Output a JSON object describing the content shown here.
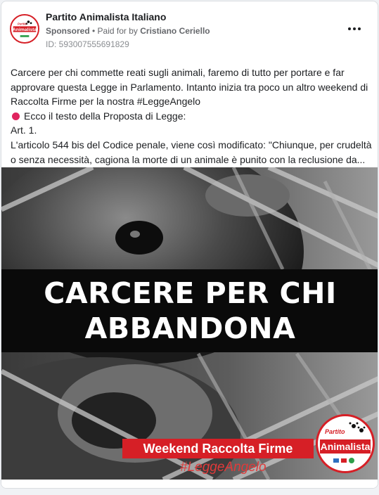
{
  "post": {
    "page_name": "Partito Animalista Italiano",
    "sponsored": "Sponsored",
    "paid_for_prefix": " • Paid for by ",
    "paid_for_by": "Cristiano Ceriello",
    "ad_id": "ID: 593007555691829",
    "more_icon": "more-horizontal-icon"
  },
  "text": {
    "line1": "Carcere per chi commette reati sugli animali, faremo di tutto per portare e far",
    "line2": "approvare questa Legge in Parlamento. Intanto inizia tra poco un altro weekend di",
    "line3": "Raccolta Firme per la nostra #LeggeAngelo",
    "line4": "Ecco il testo della Proposta di Legge:",
    "line5": "Art. 1.",
    "line6": "L'articolo 544 bis del Codice penale, viene così modificato: \"Chiunque, per crudeltà",
    "line7": "o senza necessità, cagiona la morte di un animale è punito con la reclusione da..."
  },
  "image": {
    "headline_line1": "CARCERE PER CHI",
    "headline_line2": "ABBANDONA",
    "banner": "Weekend Raccolta Firme",
    "hashtag": "#LeggeAngelo",
    "logo_small": "Partito",
    "logo_big": "Animalista"
  },
  "avatar": {
    "logo_small": "Partito",
    "logo_big": "Animalista"
  },
  "colors": {
    "brand_red": "#d61f26",
    "text": "#1c1e21",
    "meta": "#65676b"
  }
}
